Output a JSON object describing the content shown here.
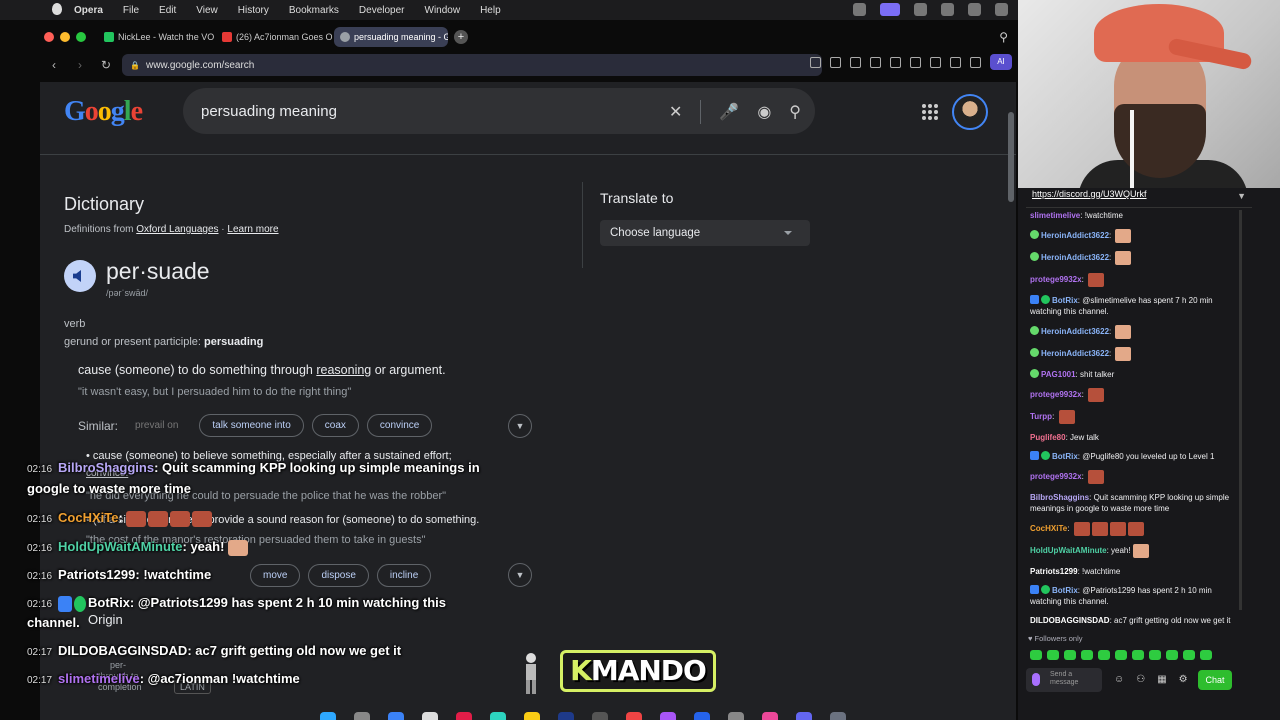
{
  "menubar": {
    "app": "Opera",
    "items": [
      "File",
      "Edit",
      "View",
      "History",
      "Bookmarks",
      "Developer",
      "Window",
      "Help"
    ]
  },
  "tabs": [
    {
      "title": "NickLee - Watch the VO",
      "icon_color": "#22c55e"
    },
    {
      "title": "(26) Ac7ionman Goes O",
      "icon_color": "#e53935"
    },
    {
      "title": "persuading meaning - G",
      "icon_color": "#9aa0a6",
      "active": true
    }
  ],
  "addressbar": {
    "url": "www.google.com/search",
    "ai_label": "AI"
  },
  "google": {
    "logo": [
      "G",
      "o",
      "o",
      "g",
      "l",
      "e"
    ],
    "query": "persuading meaning",
    "dictionary": {
      "title": "Dictionary",
      "source_prefix": "Definitions from",
      "source": "Oxford Languages",
      "sep": " · ",
      "learn_more": "Learn more",
      "word": "per·suade",
      "pronunciation": "/pərˈswād/",
      "part_of_speech": "verb",
      "gerund_label": "gerund or present participle:",
      "gerund": "persuading",
      "def1_pre": "cause (someone) to do something through ",
      "def1_link": "reasoning",
      "def1_post": " or argument.",
      "example1": "\"it wasn't easy, but I persuaded him to do the right thing\"",
      "similar_label": "Similar:",
      "similar": [
        "prevail on",
        "talk someone into",
        "coax",
        "convince"
      ],
      "def2": "• cause (someone) to believe something, especially after a sustained effort;",
      "def2_link": "convince.",
      "example2": "\"he did everything he could to persuade the police that he was the robber\"",
      "def3": "• (of a situation or event) provide a sound reason for (someone) to do something.",
      "example3": "\"the cost of the manor's restoration persuaded them to take in guests\"",
      "similar2": [
        "move",
        "dispose",
        "incline"
      ],
      "origin": "Origin",
      "etym1": "per-",
      "etym1b": "through to",
      "etym1c": "completion",
      "etym2": "LATIN"
    },
    "translate": {
      "title": "Translate to",
      "placeholder": "Choose language"
    }
  },
  "overlay_chat": [
    {
      "ts": "02:16",
      "user": "BilbroShaggins",
      "color": "#b7a7f5",
      "text": "Quit scamming KPP looking up simple meanings in",
      "text2": "google to waste more time"
    },
    {
      "ts": "02:16",
      "user": "CocHXiTe",
      "color": "#f0a030",
      "text": ""
    },
    {
      "ts": "02:16",
      "user": "HoldUpWaitAMinute",
      "color": "#4fd1a5",
      "text": "yeah!"
    },
    {
      "ts": "02:16",
      "user": "Patriots1299",
      "color": "#ffffff",
      "text": "!watchtime"
    },
    {
      "ts": "02:16",
      "user": "BotRix",
      "color": "#ffffff",
      "text": "@Patriots1299 has spent 2 h 10 min watching this",
      "text2": "channel."
    },
    {
      "ts": "02:17",
      "user": "DILDOBAGGINSDAD",
      "color": "#ffffff",
      "text": "ac7 grift getting old now we get it"
    },
    {
      "ts": "02:17",
      "user": "slimetimelive",
      "color": "#b072f0",
      "text": "@ac7ionman !watchtime"
    }
  ],
  "mando_logo": {
    "k": "K",
    "rest": "MANDO"
  },
  "twitch": {
    "link": "https://discord.gg/U3WQUrkf",
    "messages": [
      {
        "user": "slimetimelive",
        "color": "#b072f0",
        "text": "!watchtime"
      },
      {
        "user": "HeroinAddict3622",
        "color": "#8ab4f8",
        "text": ""
      },
      {
        "user": "HeroinAddict3622",
        "color": "#8ab4f8",
        "text": ""
      },
      {
        "user": "protege9932x",
        "color": "#b072f0",
        "text": ""
      },
      {
        "user": "BotRix",
        "color": "#8ab4f8",
        "text": "@slimetimelive has spent 7 h 20 min watching this channel."
      },
      {
        "user": "HeroinAddict3622",
        "color": "#8ab4f8",
        "text": ""
      },
      {
        "user": "HeroinAddict3622",
        "color": "#8ab4f8",
        "text": ""
      },
      {
        "user": "PAG1001",
        "color": "#b072f0",
        "text": "shit talker"
      },
      {
        "user": "protege9932x",
        "color": "#b072f0",
        "text": ""
      },
      {
        "user": "Turpp",
        "color": "#b072f0",
        "text": ""
      },
      {
        "user": "Puglife80",
        "color": "#f07090",
        "text": "Jew talk"
      },
      {
        "user": "BotRix",
        "color": "#8ab4f8",
        "text": "@Puglife80 you leveled up to Level 1"
      },
      {
        "user": "protege9932x",
        "color": "#b072f0",
        "text": ""
      },
      {
        "user": "BilbroShaggins",
        "color": "#b7a7f5",
        "text": "Quit scamming KPP looking up simple meanings in google to waste more time"
      },
      {
        "user": "CocHXiTe",
        "color": "#f0a030",
        "text": ""
      },
      {
        "user": "HoldUpWaitAMinute",
        "color": "#4fd1a5",
        "text": "yeah!"
      },
      {
        "user": "Patriots1299",
        "color": "#ffffff",
        "text": "!watchtime"
      },
      {
        "user": "BotRix",
        "color": "#8ab4f8",
        "text": "@Patriots1299 has spent 2 h 10 min watching this channel."
      },
      {
        "user": "DILDOBAGGINSDAD",
        "color": "#ffffff",
        "text": "ac7 grift getting old now we get it"
      }
    ],
    "followers_only": "Followers only",
    "input_placeholder": "Send a message",
    "chat_button": "Chat"
  }
}
